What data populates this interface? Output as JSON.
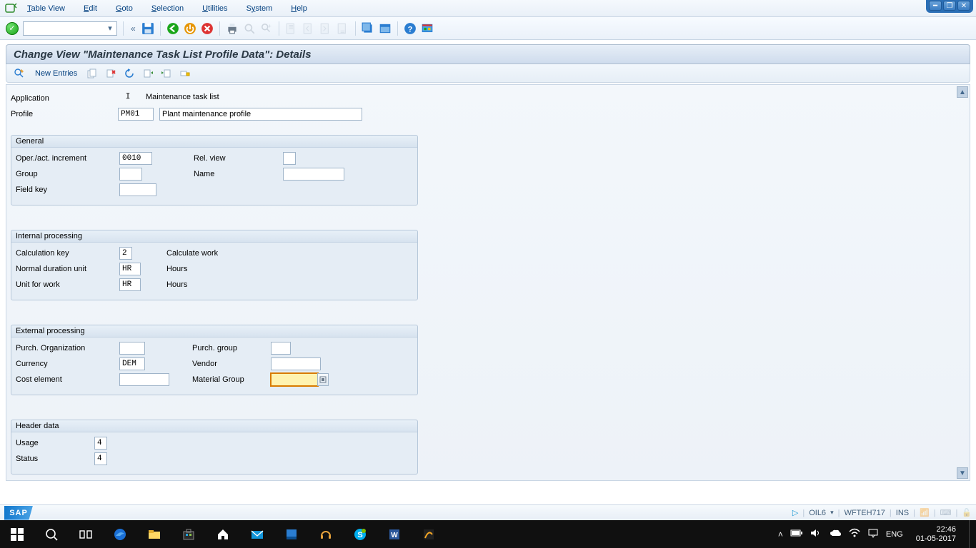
{
  "menu": {
    "table_view": "Table View",
    "edit": "Edit",
    "goto": "Goto",
    "selection": "Selection",
    "utilities": "Utilities",
    "system": "System",
    "help": "Help"
  },
  "page_title": "Change View \"Maintenance Task List Profile Data\": Details",
  "app_toolbar": {
    "new_entries": "New Entries"
  },
  "header": {
    "application_label": "Application",
    "application_value": "I",
    "application_desc": "Maintenance task list",
    "profile_label": "Profile",
    "profile_value": "PM01",
    "profile_desc": "Plant maintenance profile"
  },
  "group_general": {
    "title": "General",
    "oper_increment_label": "Oper./act. increment",
    "oper_increment_value": "0010",
    "group_label": "Group",
    "group_value": "",
    "field_key_label": "Field key",
    "field_key_value": "",
    "rel_view_label": "Rel. view",
    "rel_view_value": "",
    "name_label": "Name",
    "name_value": ""
  },
  "group_internal": {
    "title": "Internal processing",
    "calc_key_label": "Calculation key",
    "calc_key_value": "2",
    "calc_key_desc": "Calculate work",
    "dur_unit_label": "Normal duration unit",
    "dur_unit_value": "HR",
    "dur_unit_desc": "Hours",
    "work_unit_label": "Unit for work",
    "work_unit_value": "HR",
    "work_unit_desc": "Hours"
  },
  "group_external": {
    "title": "External processing",
    "purch_org_label": "Purch. Organization",
    "purch_org_value": "",
    "currency_label": "Currency",
    "currency_value": "DEM",
    "cost_elem_label": "Cost element",
    "cost_elem_value": "",
    "purch_group_label": "Purch. group",
    "purch_group_value": "",
    "vendor_label": "Vendor",
    "vendor_value": "",
    "mat_group_label": "Material Group",
    "mat_group_value": ""
  },
  "group_header": {
    "title": "Header data",
    "usage_label": "Usage",
    "usage_value": "4",
    "status_label": "Status",
    "status_value": "4"
  },
  "status_bar": {
    "system": "OIL6",
    "server": "WFTEH717",
    "mode": "INS"
  },
  "taskbar": {
    "lang": "ENG",
    "time": "22:46",
    "date": "01-05-2017"
  }
}
